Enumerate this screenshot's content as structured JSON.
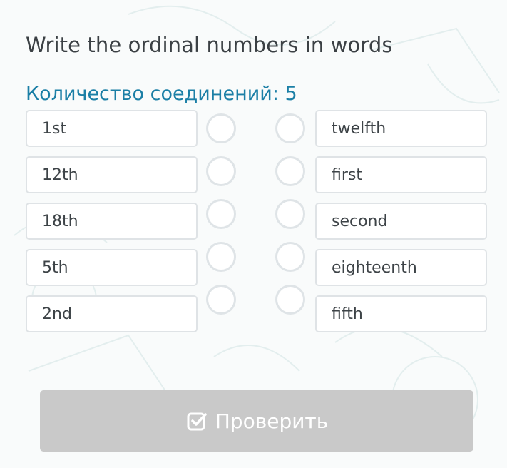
{
  "task": {
    "title": "Write the ordinal numbers in words",
    "connections_label": "Количество соединений: 5"
  },
  "left_items": [
    {
      "label": "1st"
    },
    {
      "label": "12th"
    },
    {
      "label": "18th"
    },
    {
      "label": "5th"
    },
    {
      "label": "2nd"
    }
  ],
  "right_items": [
    {
      "label": "twelfth"
    },
    {
      "label": "first"
    },
    {
      "label": "second"
    },
    {
      "label": "eighteenth"
    },
    {
      "label": "fifth"
    }
  ],
  "check_button": {
    "label": "Проверить",
    "icon": "checkbox-check-icon"
  },
  "colors": {
    "title": "#3b4044",
    "accent": "#1b7fa6",
    "button_bg": "#c9c9c9",
    "border": "#dfe3e6"
  }
}
